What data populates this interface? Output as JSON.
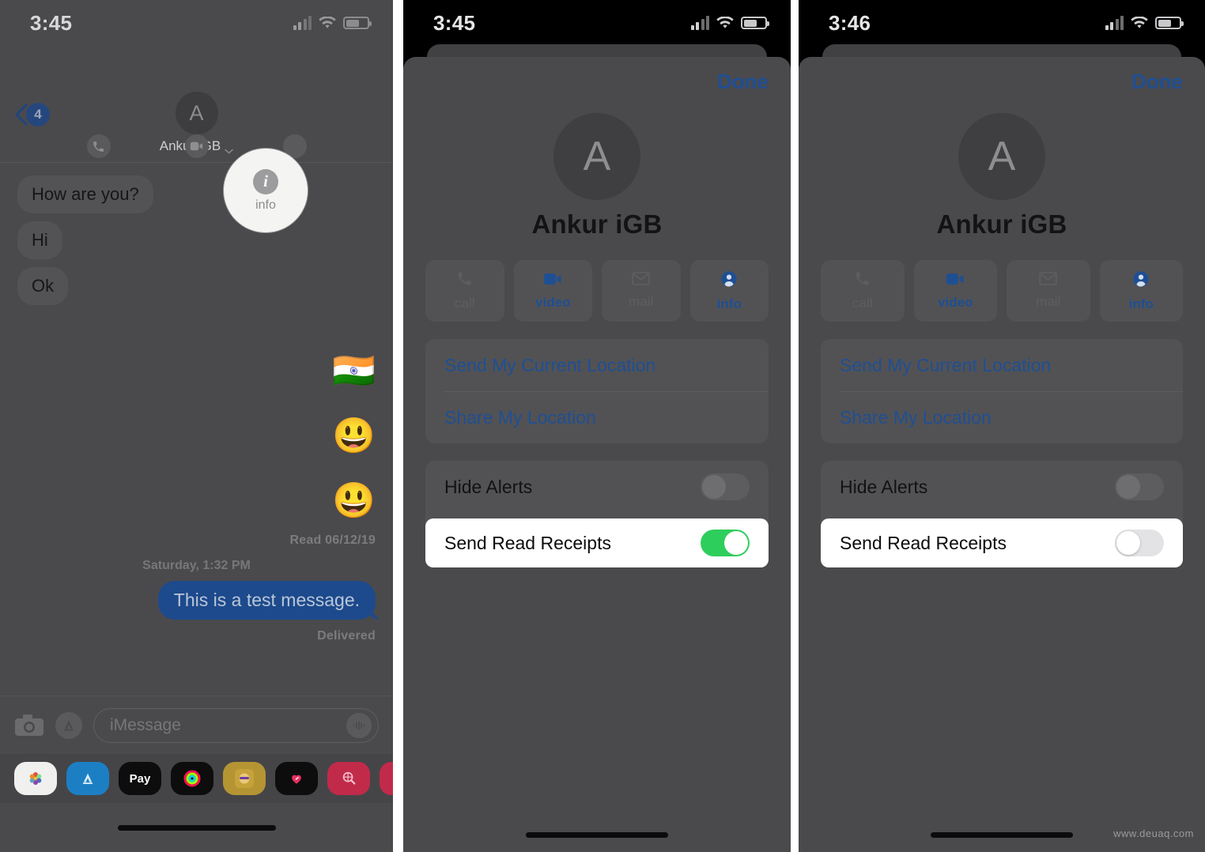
{
  "panels": [
    {
      "id": "messages-conversation",
      "status_bar": {
        "time": "3:45",
        "signal": "cellular-signal",
        "wifi": "wifi-icon",
        "battery": "battery-icon"
      },
      "header": {
        "back_badge": "4",
        "avatar_initial": "A",
        "contact_name": "Ankur iGB",
        "actions": [
          {
            "name": "audio",
            "label": "audio",
            "icon": "phone-icon"
          },
          {
            "name": "facetime",
            "label": "FaceTime",
            "icon": "video-icon"
          },
          {
            "name": "info",
            "label": "info",
            "icon": "info-icon"
          }
        ]
      },
      "spotlight": {
        "label": "info",
        "glyph": "i"
      },
      "conversation": {
        "incoming": [
          "How are you?",
          "Hi",
          "Ok"
        ],
        "outgoing_emoji": [
          "🇮🇳",
          "😃",
          "😃"
        ],
        "read_receipt": "Read 06/12/19",
        "timestamp_divider": "Saturday, 1:32 PM",
        "sent_message": "This is a test message.",
        "delivery_status": "Delivered"
      },
      "compose": {
        "placeholder": "iMessage",
        "camera_icon": "camera-icon",
        "appstore_icon": "app-store-icon",
        "mic_icon": "audio-waveform-icon"
      },
      "app_drawer": [
        {
          "name": "photos-app-icon",
          "color": "#f2f2f2"
        },
        {
          "name": "app-store-app-icon",
          "color": "#1c7fc4"
        },
        {
          "name": "apple-pay-app-icon",
          "color": "#0d0d0d"
        },
        {
          "name": "activity-rings-app-icon",
          "color": "#0d0d0d"
        },
        {
          "name": "memoji-app-icon",
          "color": "#c6a23a"
        },
        {
          "name": "digital-touch-app-icon",
          "color": "#0d0d0d"
        },
        {
          "name": "image-search-app-icon",
          "color": "#c22a4a"
        },
        {
          "name": "music-app-icon",
          "color": "#c22a4a"
        }
      ]
    },
    {
      "id": "details-read-receipts-on",
      "status_bar": {
        "time": "3:45"
      },
      "done_label": "Done",
      "avatar_initial": "A",
      "contact_name": "Ankur iGB",
      "tiles": [
        {
          "name": "call",
          "label": "call",
          "icon": "phone-icon",
          "enabled": false
        },
        {
          "name": "video",
          "label": "video",
          "icon": "video-icon",
          "enabled": true
        },
        {
          "name": "mail",
          "label": "mail",
          "icon": "envelope-icon",
          "enabled": false
        },
        {
          "name": "info",
          "label": "info",
          "icon": "person-circle-icon",
          "enabled": true
        }
      ],
      "location_links": [
        "Send My Current Location",
        "Share My Location"
      ],
      "hide_alerts": {
        "label": "Hide Alerts",
        "on": false
      },
      "send_read_receipts": {
        "label": "Send Read Receipts",
        "on": true
      }
    },
    {
      "id": "details-read-receipts-off",
      "status_bar": {
        "time": "3:46"
      },
      "done_label": "Done",
      "avatar_initial": "A",
      "contact_name": "Ankur iGB",
      "tiles": [
        {
          "name": "call",
          "label": "call",
          "icon": "phone-icon",
          "enabled": false
        },
        {
          "name": "video",
          "label": "video",
          "icon": "video-icon",
          "enabled": true
        },
        {
          "name": "mail",
          "label": "mail",
          "icon": "envelope-icon",
          "enabled": false
        },
        {
          "name": "info",
          "label": "info",
          "icon": "person-circle-icon",
          "enabled": true
        }
      ],
      "location_links": [
        "Send My Current Location",
        "Share My Location"
      ],
      "hide_alerts": {
        "label": "Hide Alerts",
        "on": false
      },
      "send_read_receipts": {
        "label": "Send Read Receipts",
        "on": false
      }
    }
  ],
  "watermark": "www.deuaq.com",
  "colors": {
    "accent_blue": "#1f4f93",
    "toggle_on_green": "#2ece5c",
    "bubble_out_blue": "#1d4a8c",
    "dim_background": "#4a4a4d"
  }
}
